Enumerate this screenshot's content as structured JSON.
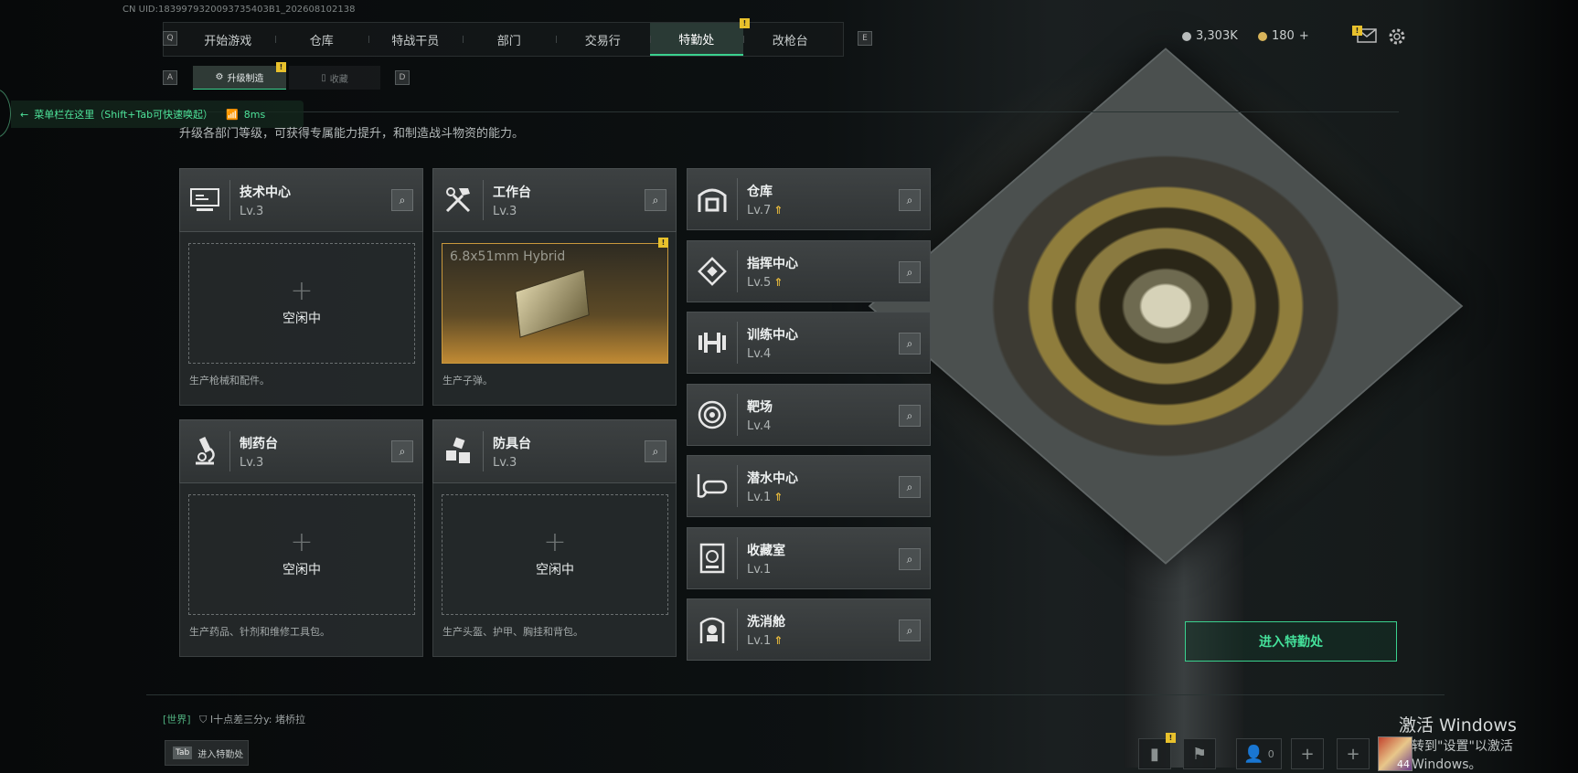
{
  "uid": "CN UID:1839979320093735403B1_202608102138",
  "nav": {
    "left_key": "Q",
    "right_key": "E",
    "tabs": [
      "开始游戏",
      "仓库",
      "特战干员",
      "部门",
      "交易行",
      "特勤处",
      "改枪台"
    ],
    "active_index": 5,
    "badge": "!"
  },
  "subtabs": {
    "left_key": "A",
    "right_key": "D",
    "items": [
      {
        "label": "升级制造",
        "active": true
      },
      {
        "label": "收藏",
        "active": false
      }
    ],
    "badge": "!"
  },
  "currency": {
    "silver": "3,303K",
    "gold": "180",
    "plus": "+"
  },
  "mail_badge": "!",
  "helper": {
    "text": "菜单栏在这里（Shift+Tab可快速唤起）",
    "ping": "8ms"
  },
  "description": "升级各部门等级，可获得专属能力提升，和制造战斗物资的能力。",
  "workshops": [
    {
      "name": "技术中心",
      "level": "Lv.3",
      "icon": "computer-icon",
      "state": "空闲中",
      "footer": "生产枪械和配件。"
    },
    {
      "name": "工作台",
      "level": "Lv.3",
      "icon": "tools-icon",
      "item": "6.8x51mm Hybrid",
      "badge": "!",
      "footer": "生产子弹。"
    },
    {
      "name": "制药台",
      "level": "Lv.3",
      "icon": "microscope-icon",
      "state": "空闲中",
      "footer": "生产药品、针剂和维修工具包。"
    },
    {
      "name": "防具台",
      "level": "Lv.3",
      "icon": "cubes-icon",
      "state": "空闲中",
      "footer": "生产头盔、护甲、胸挂和背包。"
    }
  ],
  "departments": [
    {
      "name": "仓库",
      "level": "Lv.7",
      "upgrade": true,
      "icon": "vault-icon"
    },
    {
      "name": "指挥中心",
      "level": "Lv.5",
      "upgrade": true,
      "icon": "command-icon"
    },
    {
      "name": "训练中心",
      "level": "Lv.4",
      "upgrade": false,
      "icon": "dumbbell-icon"
    },
    {
      "name": "靶场",
      "level": "Lv.4",
      "upgrade": false,
      "icon": "target-icon"
    },
    {
      "name": "潜水中心",
      "level": "Lv.1",
      "upgrade": true,
      "icon": "diving-mask-icon"
    },
    {
      "name": "收藏室",
      "level": "Lv.1",
      "upgrade": false,
      "icon": "collection-icon"
    },
    {
      "name": "洗消舱",
      "level": "Lv.1",
      "upgrade": true,
      "icon": "decon-icon"
    }
  ],
  "enter_button": "进入特勤处",
  "chat": {
    "channel": "[世界]",
    "message": "I十点差三分y: 堵桥拉"
  },
  "tab_hint": {
    "key": "Tab",
    "label": "进入特勤处"
  },
  "windows_activate": {
    "line1": "激活 Windows",
    "line2": "转到\"设置\"以激活 Windows。"
  },
  "bottom": {
    "friends_count": "0",
    "stats_badge": "!",
    "avatar_level": "44"
  },
  "colors": {
    "accent": "#3ad18e",
    "badge": "#e8c12c",
    "upgrade": "#e6b93c"
  }
}
